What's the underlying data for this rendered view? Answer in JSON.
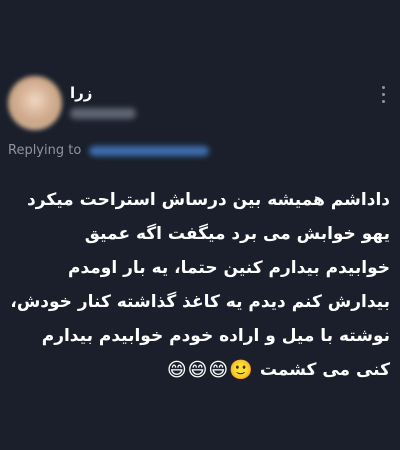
{
  "author": {
    "display_name": "زرا",
    "avatar_icon": "blurred-avatar-icon",
    "handle_redacted": true
  },
  "more_icon": "vertical-ellipsis-icon",
  "replying": {
    "label": "Replying to",
    "mention_redacted": true
  },
  "tweet": {
    "lines": [
      "داداشم همیشه بین درساش استراحت میکرد",
      "یهو خوابش می برد میگفت اگه عمیق",
      "خوابیدم بیدارم کنین حتما، یه بار اومدم",
      "بیدارش کنم دیدم یه کاغذ گذاشته کنار خودش،",
      "نوشته با میل و اراده خودم خوابیدم بیدارم",
      "کنی می کشمت"
    ],
    "emojis": "😄😄😄🙂"
  },
  "colors": {
    "background": "#1a1f2b",
    "text": "#ffffff",
    "muted": "#8b95a3",
    "accent": "#3d6fae"
  }
}
